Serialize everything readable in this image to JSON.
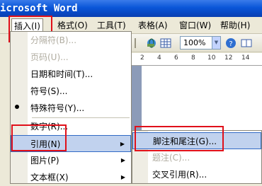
{
  "window": {
    "title": "icrosoft Word"
  },
  "menubar": {
    "items": [
      {
        "label": "插入(I)"
      },
      {
        "label": "格式(O)"
      },
      {
        "label": "工具(T)"
      },
      {
        "label": "表格(A)"
      },
      {
        "label": "窗口(W)"
      },
      {
        "label": "帮助(H)"
      }
    ]
  },
  "toolbar": {
    "zoom": "100%"
  },
  "ruler": {
    "ticks": [
      "2",
      "4",
      "6",
      "8",
      "10",
      "12",
      "14"
    ]
  },
  "insert_menu": {
    "items": [
      {
        "label": "分隔符(B)...",
        "disabled": true
      },
      {
        "label": "页码(U)...",
        "disabled": true
      },
      {
        "label": "日期和时间(T)...",
        "disabled": false
      },
      {
        "label": "符号(S)...",
        "disabled": false
      },
      {
        "label": "特殊符号(Y)...",
        "disabled": false
      },
      {
        "label": "数字(R)...",
        "disabled": false
      },
      {
        "label": "引用(N)",
        "disabled": false
      },
      {
        "label": "图片(P)",
        "disabled": false
      },
      {
        "label": "文本框(X)",
        "disabled": false
      }
    ]
  },
  "reference_submenu": {
    "items": [
      {
        "label": "脚注和尾注(G)...",
        "disabled": false
      },
      {
        "label": "题注(C)...",
        "disabled": true
      },
      {
        "label": "交叉引用(R)...",
        "disabled": false
      }
    ]
  },
  "colors": {
    "highlight": "#c1d2ee",
    "annotation_red": "#e0101a",
    "titlebar": "#0a56d8"
  }
}
